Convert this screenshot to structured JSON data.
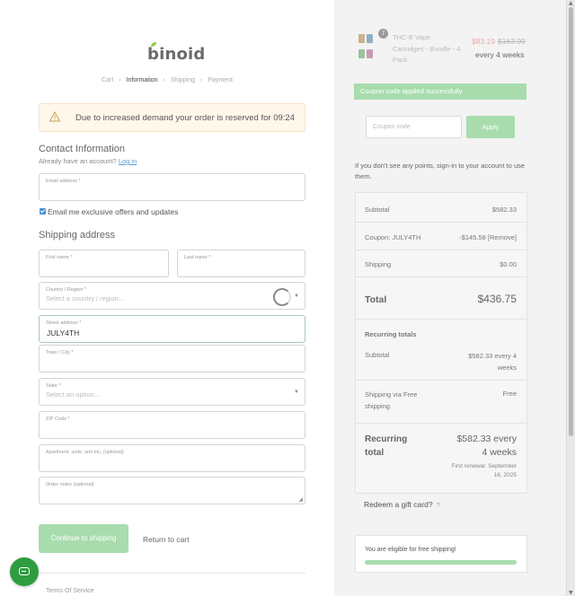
{
  "brand": {
    "logo_text": "binoid",
    "accent": "#8bd03f"
  },
  "breadcrumb": [
    "Cart",
    "Information",
    "Shipping",
    "Payment"
  ],
  "breadcrumb_active": "Information",
  "notice": {
    "icon": "warning-icon",
    "text": "Due to increased demand your order is reserved for 09:24"
  },
  "contact": {
    "heading": "Contact Information",
    "account_prompt": "Already have an account?",
    "login_link": "Log in",
    "email_label": "Email address *",
    "email_value": "",
    "newsletter_label": "Email me exclusive offers and updates",
    "newsletter_checked": true
  },
  "shipping": {
    "heading": "Shipping address",
    "first_name_label": "First name *",
    "last_name_label": "Last name *",
    "country_label": "Country / Region *",
    "country_placeholder": "Select a country / region…",
    "street_label": "Street address *",
    "street_value": "JULY4TH",
    "city_label": "Town / City *",
    "state_label": "State *",
    "state_placeholder": "Select an option…",
    "zip_label": "ZIP Code *",
    "apartment_label": "Apartment, suite, unit etc. (optional)",
    "notes_label": "Order notes (optional)"
  },
  "actions": {
    "continue_label": "Continue to shipping",
    "return_label": "Return to cart"
  },
  "footer": {
    "terms_label": "Terms Of Service"
  },
  "chat": {
    "icon": "chat-icon"
  },
  "product": {
    "quantity": "7",
    "name": "THC-B Vape Cartridges - Bundle - 4 Pack",
    "sale_price": "$83.19",
    "regular_price": "$163.99",
    "frequency": "every 4 weeks"
  },
  "coupon": {
    "success_message": "Coupon code applied successfully.",
    "placeholder": "Coupon code",
    "apply_label": "Apply"
  },
  "points_message": "If you don't see any points, sign-in to your account to use them.",
  "totals": {
    "subtotal_label": "Subtotal",
    "subtotal_value": "$582.33",
    "coupon_label": "Coupon: JULY4TH",
    "coupon_value": "-$145.58 [Remove]",
    "shipping_label": "Shipping",
    "shipping_value": "$0.00",
    "total_label": "Total",
    "total_value": "$436.75",
    "recurring_heading": "Recurring totals",
    "recurring_subtotal_label": "Subtotal",
    "recurring_subtotal_value": "$582.33 every 4 weeks",
    "recurring_shipping_label": "Shipping via Free shipping",
    "recurring_shipping_value": "Free",
    "recurring_total_label": "Recurring total",
    "recurring_total_value": "$582.33 every 4 weeks",
    "first_renewal": "First renewal: September 16, 2025"
  },
  "gift": {
    "label": "Redeem a gift card?",
    "help": "?"
  },
  "free_shipping": {
    "message": "You are eligible for free shipping!",
    "progress": 1.0
  },
  "colors": {
    "green_button": "#a8dcad",
    "sale_red": "#e8a7a7",
    "link_blue": "#5b9bd5"
  }
}
